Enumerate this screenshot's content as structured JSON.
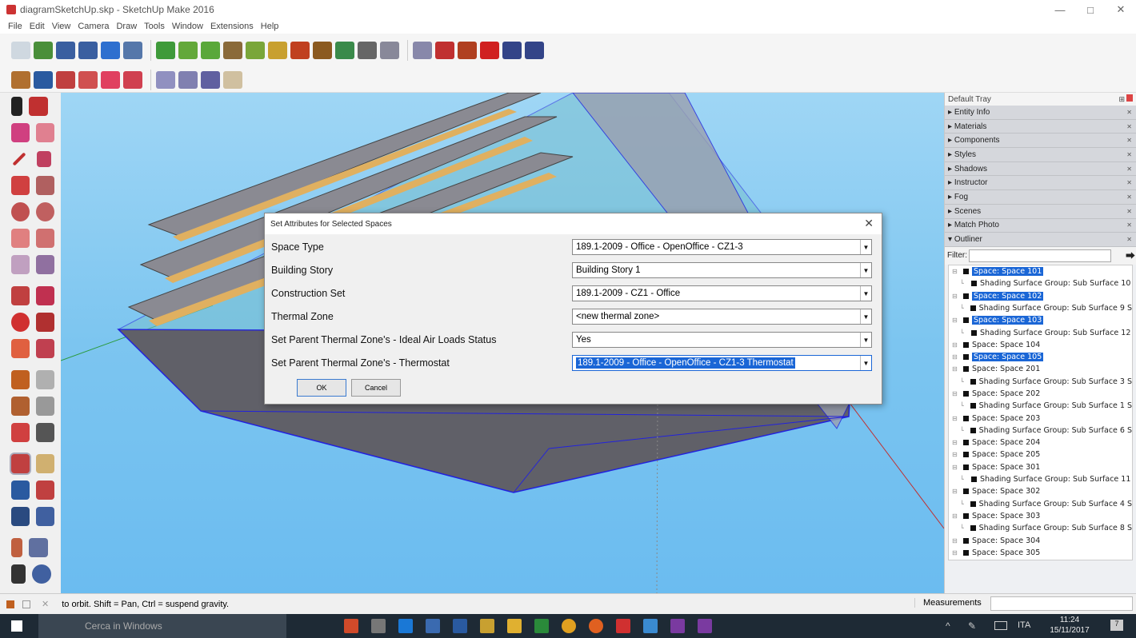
{
  "window": {
    "title": "diagramSketchUp.skp - SketchUp Make 2016",
    "min": "—",
    "max": "□",
    "close": "✕"
  },
  "menu": [
    "File",
    "Edit",
    "View",
    "Camera",
    "Draw",
    "Tools",
    "Window",
    "Extensions",
    "Help"
  ],
  "dialog": {
    "title": "Set Attributes for Selected Spaces",
    "close": "✕",
    "rows": [
      {
        "label": "Space Type",
        "value": "189.1-2009 - Office - OpenOffice - CZ1-3"
      },
      {
        "label": "Building Story",
        "value": "Building Story 1"
      },
      {
        "label": "Construction Set",
        "value": "189.1-2009 - CZ1 - Office"
      },
      {
        "label": "Thermal Zone",
        "value": "<new thermal zone>"
      },
      {
        "label": "Set Parent Thermal Zone's - Ideal Air Loads Status",
        "value": "Yes"
      },
      {
        "label": "Set Parent Thermal Zone's - Thermostat",
        "value": "189.1-2009 - Office - OpenOffice - CZ1-3 Thermostat"
      }
    ],
    "ok": "OK",
    "cancel": "Cancel"
  },
  "tray": {
    "title": "Default Tray",
    "panels": [
      "Entity Info",
      "Materials",
      "Components",
      "Styles",
      "Shadows",
      "Instructor",
      "Fog",
      "Scenes",
      "Match Photo"
    ],
    "outliner": "Outliner",
    "filter_label": "Filter:",
    "items": [
      {
        "text": "Space: Space 101",
        "sel": true,
        "lvl": 0
      },
      {
        "text": "Shading Surface Group: Sub Surface 10",
        "sel": false,
        "lvl": 1
      },
      {
        "text": "Space: Space 102",
        "sel": true,
        "lvl": 0
      },
      {
        "text": "Shading Surface Group: Sub Surface 9 S",
        "sel": false,
        "lvl": 1
      },
      {
        "text": "Space: Space 103",
        "sel": true,
        "lvl": 0
      },
      {
        "text": "Shading Surface Group: Sub Surface 12",
        "sel": false,
        "lvl": 1
      },
      {
        "text": "Space: Space 104",
        "sel": false,
        "lvl": 0
      },
      {
        "text": "Space: Space 105",
        "sel": true,
        "lvl": 0
      },
      {
        "text": "Space: Space 201",
        "sel": false,
        "lvl": 0
      },
      {
        "text": "Shading Surface Group: Sub Surface 3 S",
        "sel": false,
        "lvl": 1
      },
      {
        "text": "Space: Space 202",
        "sel": false,
        "lvl": 0
      },
      {
        "text": "Shading Surface Group: Sub Surface 1 S",
        "sel": false,
        "lvl": 1
      },
      {
        "text": "Space: Space 203",
        "sel": false,
        "lvl": 0
      },
      {
        "text": "Shading Surface Group: Sub Surface 6 S",
        "sel": false,
        "lvl": 1
      },
      {
        "text": "Space: Space 204",
        "sel": false,
        "lvl": 0
      },
      {
        "text": "Space: Space 205",
        "sel": false,
        "lvl": 0
      },
      {
        "text": "Space: Space 301",
        "sel": false,
        "lvl": 0
      },
      {
        "text": "Shading Surface Group: Sub Surface 11",
        "sel": false,
        "lvl": 1
      },
      {
        "text": "Space: Space 302",
        "sel": false,
        "lvl": 0
      },
      {
        "text": "Shading Surface Group: Sub Surface 4 S",
        "sel": false,
        "lvl": 1
      },
      {
        "text": "Space: Space 303",
        "sel": false,
        "lvl": 0
      },
      {
        "text": "Shading Surface Group: Sub Surface 8 S",
        "sel": false,
        "lvl": 1
      },
      {
        "text": "Space: Space 304",
        "sel": false,
        "lvl": 0
      },
      {
        "text": "Space: Space 305",
        "sel": false,
        "lvl": 0
      }
    ]
  },
  "status": {
    "hint": "to orbit. Shift = Pan, Ctrl = suspend gravity.",
    "measurements": "Measurements"
  },
  "taskbar": {
    "search": "Cerca in Windows",
    "lang": "ITA",
    "time": "11:24",
    "date": "15/11/2017",
    "notif": "7"
  },
  "colors": {
    "selection": "#1a66d6",
    "sky": "#7cc5f0",
    "taskbar": "#1e2a35"
  }
}
